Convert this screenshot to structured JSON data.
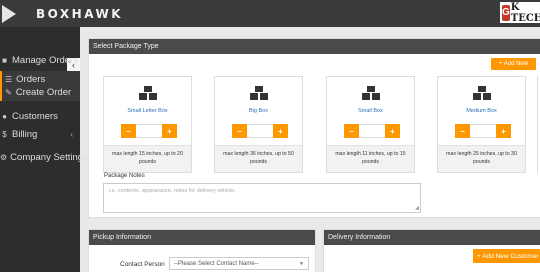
{
  "header": {
    "brand": "BOXHAWK",
    "partner_badge": "G",
    "partner_text": "K TECH"
  },
  "sidebar": {
    "collapse_glyph": "‹",
    "manage_orders": "Manage Orders",
    "orders": "Orders",
    "create_order": "Create Order",
    "customers": "Customers",
    "billing": "Billing",
    "company_settings": "Company Settings"
  },
  "package_panel": {
    "title": "Select Package Type",
    "add_new": "+ Add New",
    "minus": "−",
    "plus": "+",
    "boxes": [
      {
        "name": "Small Letter Box",
        "desc": "max length 15 inches, up to 20 pounds"
      },
      {
        "name": "Big Box",
        "desc": "max length 36 inches, up to 50 pounds"
      },
      {
        "name": "Small Box",
        "desc": "max length 11 inches, up to 15 pounds"
      },
      {
        "name": "Medium Box",
        "desc": "max length 25 inches, up to 30 pounds"
      }
    ],
    "notes_label": "Package Notes",
    "notes_placeholder": "i.e. contents, appearance, notes for delivery vehicle."
  },
  "pickup_panel": {
    "title": "Pickup Information",
    "contact_label": "Contact Person",
    "contact_select": "--Please Select Contact Name--"
  },
  "delivery_panel": {
    "title": "Delivery Information",
    "add_customer": "+ Add New Customer"
  },
  "colors": {
    "accent": "#ff9800",
    "link": "#2a6ebb",
    "header_bg": "#3a3a3a",
    "sidebar_bg": "#2d2d2d"
  }
}
